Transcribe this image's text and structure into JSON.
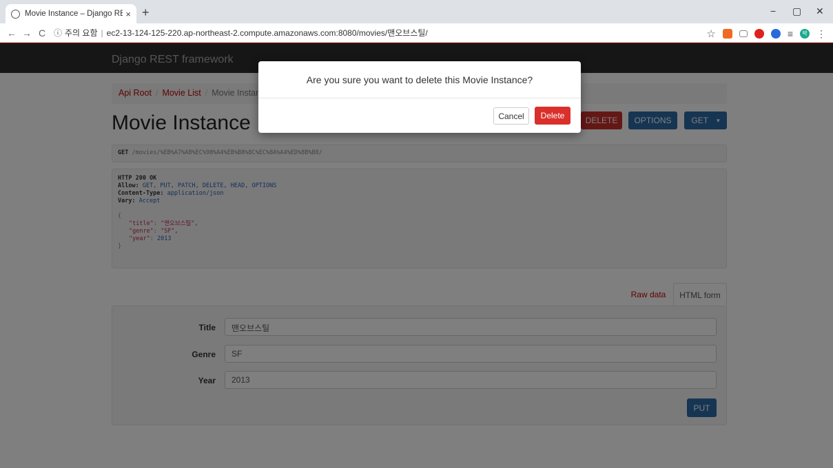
{
  "browser": {
    "tab_title": "Movie Instance – Django REST F",
    "tab_close": "×",
    "new_tab": "+",
    "win_minimize": "−",
    "win_maximize": "▢",
    "win_close": "✕",
    "back": "←",
    "forward": "→",
    "reload": "C",
    "info": "ⓘ",
    "security_text": "주의 요함",
    "separator": "|",
    "url": "ec2-13-124-125-220.ap-northeast-2.compute.amazonaws.com:8080/movies/맨오브스틸/",
    "star": "☆",
    "menu": "⋮",
    "profile_initial": "박",
    "reading_list": "≡"
  },
  "navbar": {
    "brand": "Django REST framework"
  },
  "breadcrumb": {
    "items": [
      "Api Root",
      "Movie List",
      "Movie Instance"
    ],
    "divider": "/"
  },
  "page": {
    "title": "Movie Instance",
    "delete_label": "DELETE",
    "options_label": "OPTIONS",
    "get_label": "GET",
    "get_caret": "▾"
  },
  "request": {
    "method": "GET",
    "path": "/movies/%EB%A7%A8%EC%98%A4%EB%B8%8C%EC%8A%A4%ED%8B%B8/"
  },
  "response": {
    "status": "HTTP 200 OK",
    "headers": [
      {
        "key": "Allow:",
        "value": "GET, PUT, PATCH, DELETE, HEAD, OPTIONS"
      },
      {
        "key": "Content-Type:",
        "value": "application/json"
      },
      {
        "key": "Vary:",
        "value": "Accept"
      }
    ],
    "open_brace": "{",
    "close_brace": "}",
    "body": [
      {
        "key": "\"title\"",
        "value": "\"맨오브스틸\","
      },
      {
        "key": "\"genre\"",
        "value": "\"SF\","
      },
      {
        "key": "\"year\"",
        "value": "2013"
      }
    ]
  },
  "form_tabs": {
    "raw": "Raw data",
    "html": "HTML form"
  },
  "form": {
    "fields": [
      {
        "label": "Title",
        "value": "맨오브스틸"
      },
      {
        "label": "Genre",
        "value": "SF"
      },
      {
        "label": "Year",
        "value": "2013"
      }
    ],
    "put_label": "PUT"
  },
  "modal": {
    "message": "Are you sure you want to delete this Movie Instance?",
    "cancel_label": "Cancel",
    "delete_label": "Delete"
  },
  "colors": {
    "accent": "#c20000",
    "primary": "#2c6aa6",
    "danger": "#d9302b"
  }
}
